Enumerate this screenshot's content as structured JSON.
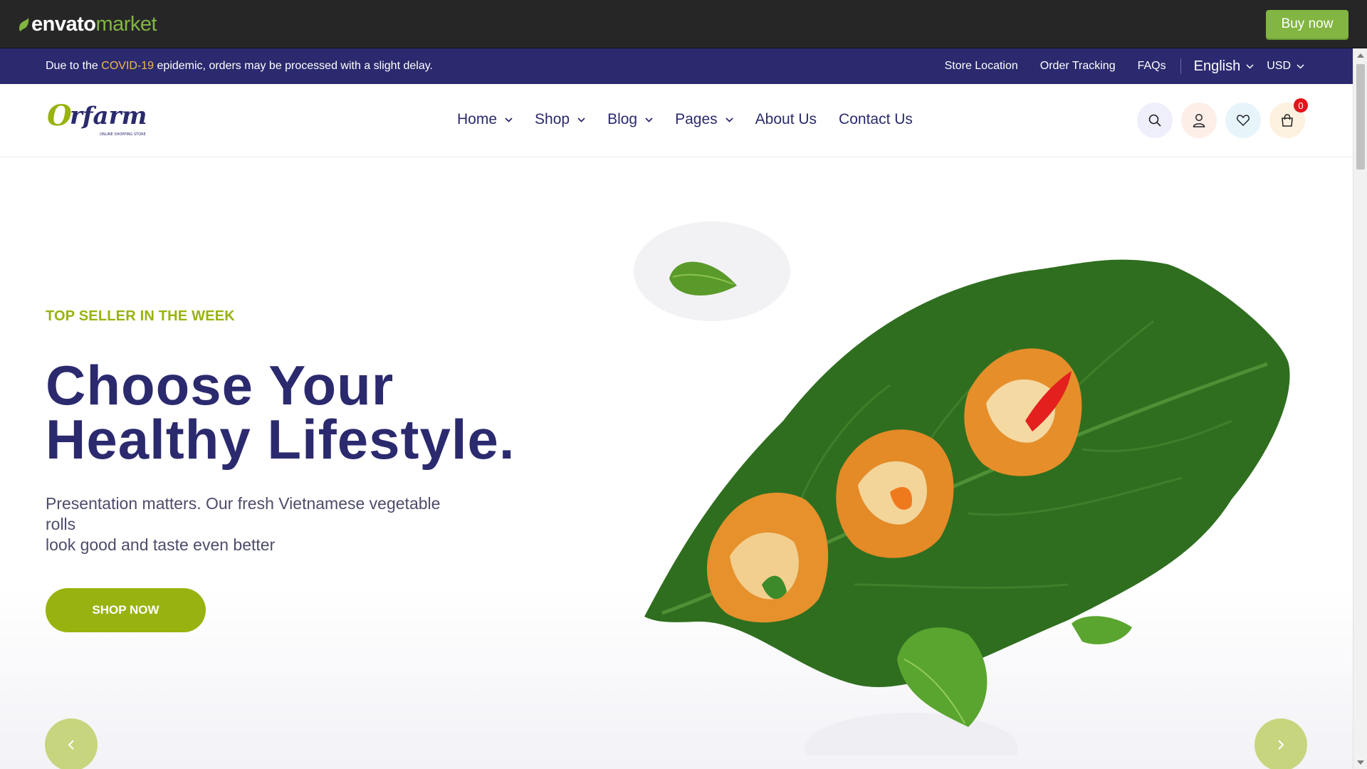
{
  "envato": {
    "brand": "envato",
    "market": "market",
    "buy_now": "Buy now"
  },
  "notice": {
    "before": "Due to the ",
    "highlight": "COVID-19",
    "after": " epidemic, orders may be processed with a slight delay."
  },
  "top_links": {
    "store_location": "Store Location",
    "order_tracking": "Order Tracking",
    "faqs": "FAQs",
    "language": "English",
    "currency": "USD"
  },
  "logo": {
    "text": "Orfarm",
    "tagline": "ONLINE SHOPPING STORE"
  },
  "nav": {
    "home": "Home",
    "shop": "Shop",
    "blog": "Blog",
    "pages": "Pages",
    "about": "About Us",
    "contact": "Contact Us"
  },
  "header_icons": {
    "search": "search-icon",
    "user": "user-icon",
    "wishlist": "heart-icon",
    "cart": "cart-icon",
    "cart_count": "0"
  },
  "hero": {
    "eyebrow": "TOP SELLER IN THE WEEK",
    "headline_line1": "Choose Your",
    "headline_line2": "Healthy Lifestyle.",
    "subtext_line1": "Presentation matters. Our fresh Vietnamese vegetable rolls",
    "subtext_line2": "look good and taste even better",
    "cta": "SHOP NOW",
    "prev_icon": "chevron-left-icon",
    "next_icon": "chevron-right-icon"
  },
  "colors": {
    "envato_bar": "#262626",
    "envato_green": "#82b541",
    "notice_bg": "#2b2a6e",
    "notice_highlight": "#f0b84b",
    "brand_navy": "#2b2a6e",
    "brand_green": "#98b30f",
    "badge_red": "#e3161b"
  }
}
